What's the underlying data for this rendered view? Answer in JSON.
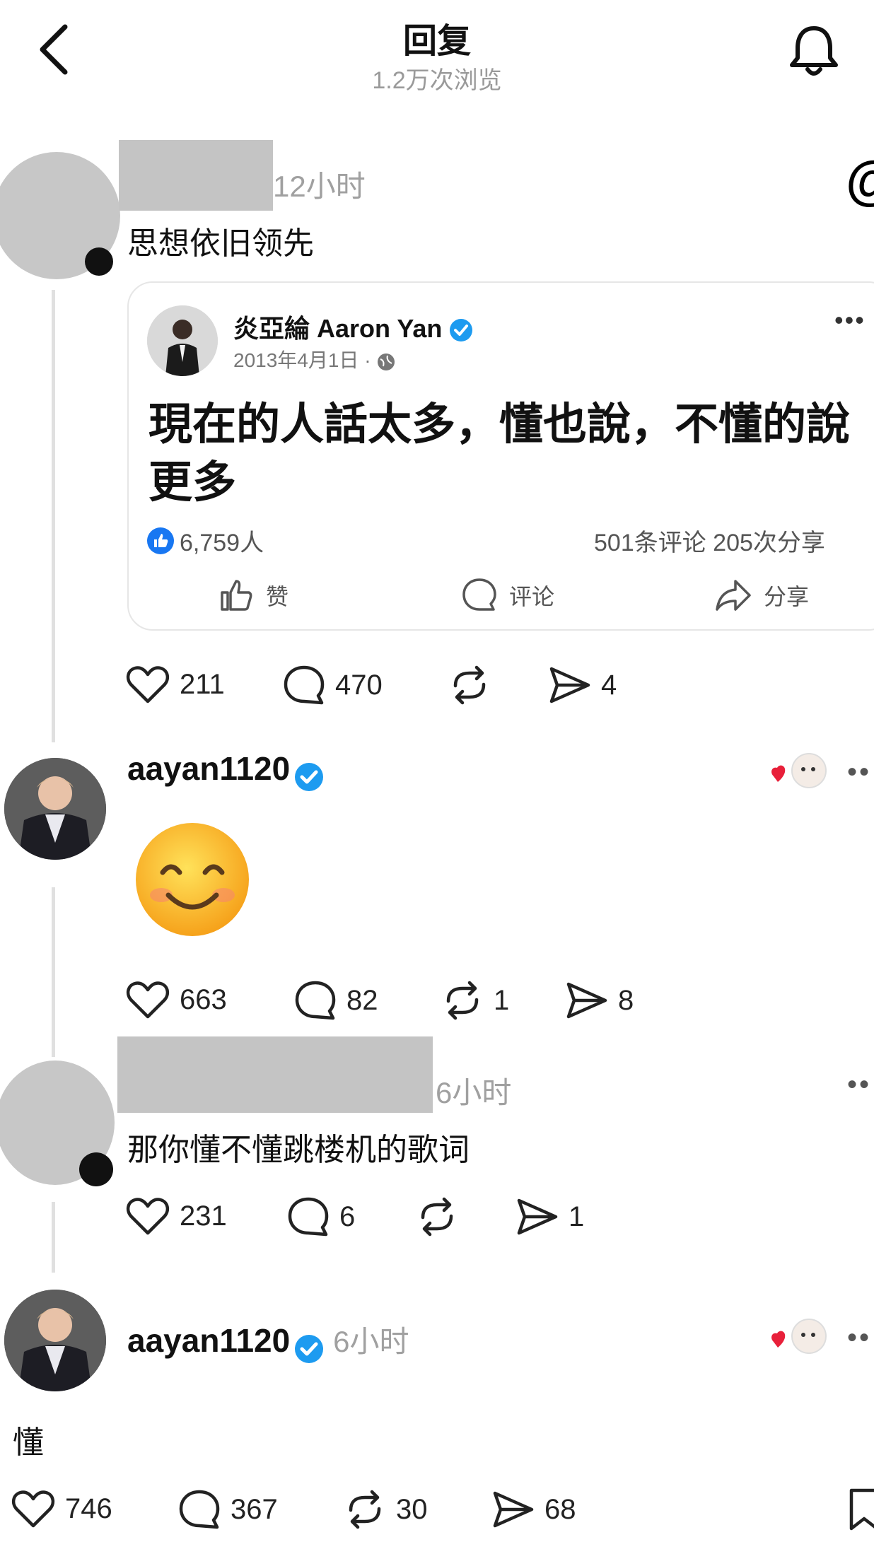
{
  "header": {
    "title": "回复",
    "views": "1.2万次浏览"
  },
  "post1": {
    "time": "12小时",
    "text": "思想依旧领先",
    "quote": {
      "name": "炎亞綸 Aaron Yan",
      "date": "2013年4月1日 ·",
      "text": "現在的人話太多，懂也說，不懂的說更多",
      "likes": "6,759人",
      "stats": "501条评论  205次分享",
      "like_label": "赞",
      "comment_label": "评论",
      "share_label": "分享"
    },
    "actions": {
      "likes": "211",
      "comments": "470",
      "reposts": "",
      "shares": "4"
    }
  },
  "post2": {
    "username": "aayan1120",
    "emoji": "😊",
    "actions": {
      "likes": "663",
      "comments": "82",
      "reposts": "1",
      "shares": "8"
    }
  },
  "post3": {
    "time": "6小时",
    "text": "那你懂不懂跳楼机的歌词",
    "actions": {
      "likes": "231",
      "comments": "6",
      "reposts": "",
      "shares": "1"
    }
  },
  "post4": {
    "username": "aayan1120",
    "time": "6小时",
    "text": "懂",
    "actions": {
      "likes": "746",
      "comments": "367",
      "reposts": "30",
      "shares": "68"
    }
  },
  "threads_logo": "@",
  "colors": {
    "verified": "#1d9bf0",
    "facebook_like": "#1877f2",
    "heart": "#e8203a"
  }
}
